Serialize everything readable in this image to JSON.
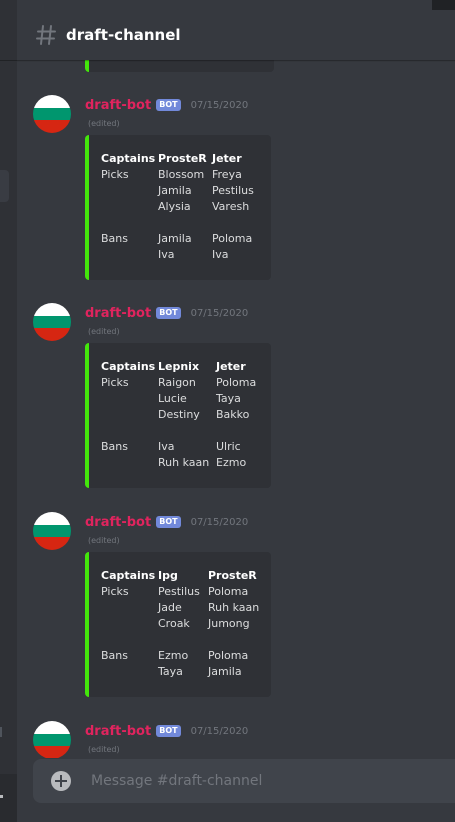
{
  "channel": {
    "name": "draft-channel"
  },
  "composer": {
    "placeholder": "Message #draft-channel"
  },
  "colors": {
    "embed_border": "#43e60b",
    "author": "#e0245e",
    "bot_tag": "#7289da"
  },
  "messages": [
    {
      "author": "draft-bot",
      "tag": "BOT",
      "timestamp": "07/15/2020",
      "edited": "(edited)",
      "avatar": "bulgaria-flag-avatar",
      "embed": {
        "fields": [
          {
            "name": "Captains",
            "picks": [
              "Picks"
            ],
            "bans": [
              "Bans"
            ]
          },
          {
            "name": "ProsteR",
            "picks": [
              "Blossom",
              "Jamila",
              "Alysia"
            ],
            "bans": [
              "Jamila",
              "Iva"
            ]
          },
          {
            "name": "Jeter",
            "picks": [
              "Freya",
              "Pestilus",
              "Varesh"
            ],
            "bans": [
              "Poloma",
              "Iva"
            ]
          }
        ]
      }
    },
    {
      "author": "draft-bot",
      "tag": "BOT",
      "timestamp": "07/15/2020",
      "edited": "(edited)",
      "avatar": "bulgaria-flag-avatar",
      "embed": {
        "fields": [
          {
            "name": "Captains",
            "picks": [
              "Picks"
            ],
            "bans": [
              "Bans"
            ]
          },
          {
            "name": "Lepnix",
            "picks": [
              "Raigon",
              "Lucie",
              "Destiny"
            ],
            "bans": [
              "Iva",
              "Ruh kaan"
            ]
          },
          {
            "name": "Jeter",
            "picks": [
              "Poloma",
              "Taya",
              "Bakko"
            ],
            "bans": [
              "Ulric",
              "Ezmo"
            ]
          }
        ]
      }
    },
    {
      "author": "draft-bot",
      "tag": "BOT",
      "timestamp": "07/15/2020",
      "edited": "(edited)",
      "avatar": "bulgaria-flag-avatar",
      "embed": {
        "fields": [
          {
            "name": "Captains",
            "picks": [
              "Picks"
            ],
            "bans": [
              "Bans"
            ]
          },
          {
            "name": "Ipg",
            "picks": [
              "Pestilus",
              "Jade",
              "Croak"
            ],
            "bans": [
              "Ezmo",
              "Taya"
            ]
          },
          {
            "name": "ProsteR",
            "picks": [
              "Poloma",
              "Ruh kaan",
              "Jumong"
            ],
            "bans": [
              "Poloma",
              "Jamila"
            ]
          }
        ]
      }
    },
    {
      "author": "draft-bot",
      "tag": "BOT",
      "timestamp": "07/15/2020",
      "edited": "(edited)",
      "avatar": "bulgaria-flag-avatar"
    }
  ]
}
